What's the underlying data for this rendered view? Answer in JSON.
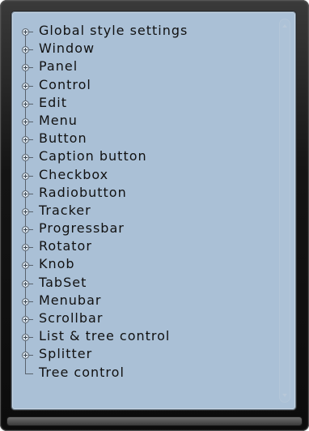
{
  "tree": {
    "items": [
      {
        "label": "Global style settings",
        "expandable": true
      },
      {
        "label": "Window",
        "expandable": true
      },
      {
        "label": "Panel",
        "expandable": true
      },
      {
        "label": "Control",
        "expandable": true
      },
      {
        "label": "Edit",
        "expandable": true
      },
      {
        "label": "Menu",
        "expandable": true
      },
      {
        "label": "Button",
        "expandable": true
      },
      {
        "label": "Caption button",
        "expandable": true
      },
      {
        "label": "Checkbox",
        "expandable": true
      },
      {
        "label": "Radiobutton",
        "expandable": true
      },
      {
        "label": "Tracker",
        "expandable": true
      },
      {
        "label": "Progressbar",
        "expandable": true
      },
      {
        "label": "Rotator",
        "expandable": true
      },
      {
        "label": "Knob",
        "expandable": true
      },
      {
        "label": "TabSet",
        "expandable": true
      },
      {
        "label": "Menubar",
        "expandable": true
      },
      {
        "label": "Scrollbar",
        "expandable": true
      },
      {
        "label": "List & tree control",
        "expandable": true
      },
      {
        "label": "Splitter",
        "expandable": true
      },
      {
        "label": "Tree control",
        "expandable": false
      }
    ]
  },
  "colors": {
    "panel_background": "#aac0d6",
    "frame": "#141414",
    "text": "#111111",
    "tree_lines": "#59636e"
  },
  "icons": {
    "expander": "plus-circle-icon",
    "scroll_up": "arrow-up-icon",
    "scroll_down": "arrow-down-icon"
  }
}
